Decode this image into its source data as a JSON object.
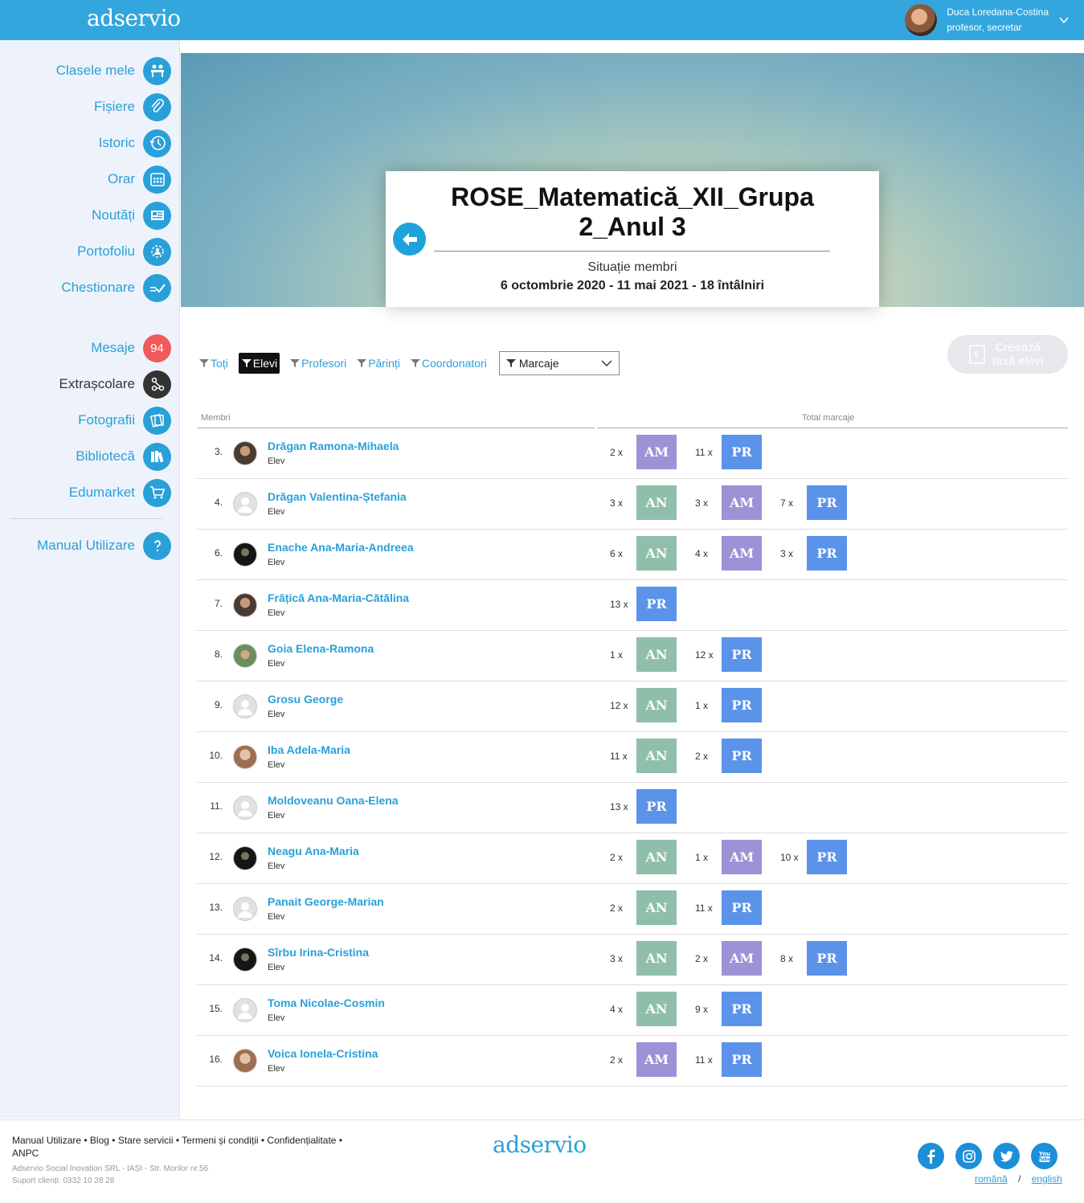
{
  "header": {
    "logo": "adservio",
    "user_name": "Duca Loredana-Costina",
    "user_role": "profesor, secretar"
  },
  "sidebar": {
    "items": [
      {
        "label": "Clasele mele",
        "icon": "classes-icon"
      },
      {
        "label": "Fișiere",
        "icon": "paperclip-icon"
      },
      {
        "label": "Istoric",
        "icon": "history-icon"
      },
      {
        "label": "Orar",
        "icon": "calendar-icon"
      },
      {
        "label": "Noutăți",
        "icon": "news-icon"
      },
      {
        "label": "Portofoliu",
        "icon": "portfolio-icon"
      },
      {
        "label": "Chestionare",
        "icon": "checklist-icon"
      },
      {
        "label": "Mesaje",
        "badge": "94"
      },
      {
        "label": "Extrașcolare",
        "icon": "share-icon"
      },
      {
        "label": "Fotografii",
        "icon": "photos-icon"
      },
      {
        "label": "Bibliotecă",
        "icon": "books-icon"
      },
      {
        "label": "Edumarket",
        "icon": "cart-icon"
      },
      {
        "label": "Manual Utilizare",
        "icon": "help-icon"
      }
    ]
  },
  "hero": {
    "title": "ROSE_Matematică_XII_Grupa 2_Anul 3",
    "subtitle": "Situație membri",
    "dates": "6 octombrie 2020 - 11 mai 2021 - 18 întâlniri"
  },
  "filters": {
    "all": "Toți",
    "students": "Elevi",
    "teachers": "Profesori",
    "parents": "Părinți",
    "coordinators": "Coordonatori",
    "select_value": "Marcaje"
  },
  "tax_button": {
    "line1": "Creează",
    "line2": "taxă elevi"
  },
  "table": {
    "col_members": "Membri",
    "col_marks": "Total marcaje",
    "rows": [
      {
        "idx": "3.",
        "name": "Drăgan Ramona-Mihaela",
        "role": "Elev",
        "avatar": "photo",
        "marks": [
          {
            "count": "2 x",
            "code": "AM"
          },
          {
            "count": "11 x",
            "code": "PR"
          }
        ]
      },
      {
        "idx": "4.",
        "name": "Drăgan Valentina-Ștefania",
        "role": "Elev",
        "avatar": "def",
        "marks": [
          {
            "count": "3 x",
            "code": "AN"
          },
          {
            "count": "3 x",
            "code": "AM"
          },
          {
            "count": "7 x",
            "code": "PR"
          }
        ]
      },
      {
        "idx": "6.",
        "name": "Enache Ana-Maria-Andreea",
        "role": "Elev",
        "avatar": "dark",
        "marks": [
          {
            "count": "6 x",
            "code": "AN"
          },
          {
            "count": "4 x",
            "code": "AM"
          },
          {
            "count": "3 x",
            "code": "PR"
          }
        ]
      },
      {
        "idx": "7.",
        "name": "Frățică Ana-Maria-Cătălina",
        "role": "Elev",
        "avatar": "photo",
        "marks": [
          {
            "count": "13 x",
            "code": "PR"
          }
        ]
      },
      {
        "idx": "8.",
        "name": "Goia Elena-Ramona",
        "role": "Elev",
        "avatar": "green",
        "marks": [
          {
            "count": "1 x",
            "code": "AN"
          },
          {
            "count": "12 x",
            "code": "PR"
          }
        ]
      },
      {
        "idx": "9.",
        "name": "Grosu George",
        "role": "Elev",
        "avatar": "def",
        "marks": [
          {
            "count": "12 x",
            "code": "AN"
          },
          {
            "count": "1 x",
            "code": "PR"
          }
        ]
      },
      {
        "idx": "10.",
        "name": "Iba Adela-Maria",
        "role": "Elev",
        "avatar": "light",
        "marks": [
          {
            "count": "11 x",
            "code": "AN"
          },
          {
            "count": "2 x",
            "code": "PR"
          }
        ]
      },
      {
        "idx": "11.",
        "name": "Moldoveanu Oana-Elena",
        "role": "Elev",
        "avatar": "def",
        "marks": [
          {
            "count": "13 x",
            "code": "PR"
          }
        ]
      },
      {
        "idx": "12.",
        "name": "Neagu Ana-Maria",
        "role": "Elev",
        "avatar": "dark",
        "marks": [
          {
            "count": "2 x",
            "code": "AN"
          },
          {
            "count": "1 x",
            "code": "AM"
          },
          {
            "count": "10 x",
            "code": "PR"
          }
        ]
      },
      {
        "idx": "13.",
        "name": "Panait George-Marian",
        "role": "Elev",
        "avatar": "def",
        "marks": [
          {
            "count": "2 x",
            "code": "AN"
          },
          {
            "count": "11 x",
            "code": "PR"
          }
        ]
      },
      {
        "idx": "14.",
        "name": "Sîrbu Irina-Cristina",
        "role": "Elev",
        "avatar": "dark",
        "marks": [
          {
            "count": "3 x",
            "code": "AN"
          },
          {
            "count": "2 x",
            "code": "AM"
          },
          {
            "count": "8 x",
            "code": "PR"
          }
        ]
      },
      {
        "idx": "15.",
        "name": "Toma Nicolae-Cosmin",
        "role": "Elev",
        "avatar": "def",
        "marks": [
          {
            "count": "4 x",
            "code": "AN"
          },
          {
            "count": "9 x",
            "code": "PR"
          }
        ]
      },
      {
        "idx": "16.",
        "name": "Voica Ionela-Cristina",
        "role": "Elev",
        "avatar": "light",
        "marks": [
          {
            "count": "2 x",
            "code": "AM"
          },
          {
            "count": "11 x",
            "code": "PR"
          }
        ]
      }
    ]
  },
  "footer": {
    "links": [
      "Manual Utilizare",
      "Blog",
      "Stare servicii",
      "Termeni și condiții",
      "Confidențialitate",
      "ANPC"
    ],
    "address": "Adservio Social Inovation SRL - IAȘI - Str. Morilor nr.56",
    "support": "Suport clienți: 0332 10 28 28",
    "logo": "adservio",
    "lang_ro": "română",
    "lang_sep": "/",
    "lang_en": "english",
    "social": [
      "facebook-icon",
      "instagram-icon",
      "twitter-icon",
      "youtube-icon"
    ]
  },
  "colors": {
    "brand": "#33a6de",
    "AN": "#8fbfaa",
    "AM": "#9b93d6",
    "PR": "#5b93ea",
    "badge": "#f05a5a"
  }
}
